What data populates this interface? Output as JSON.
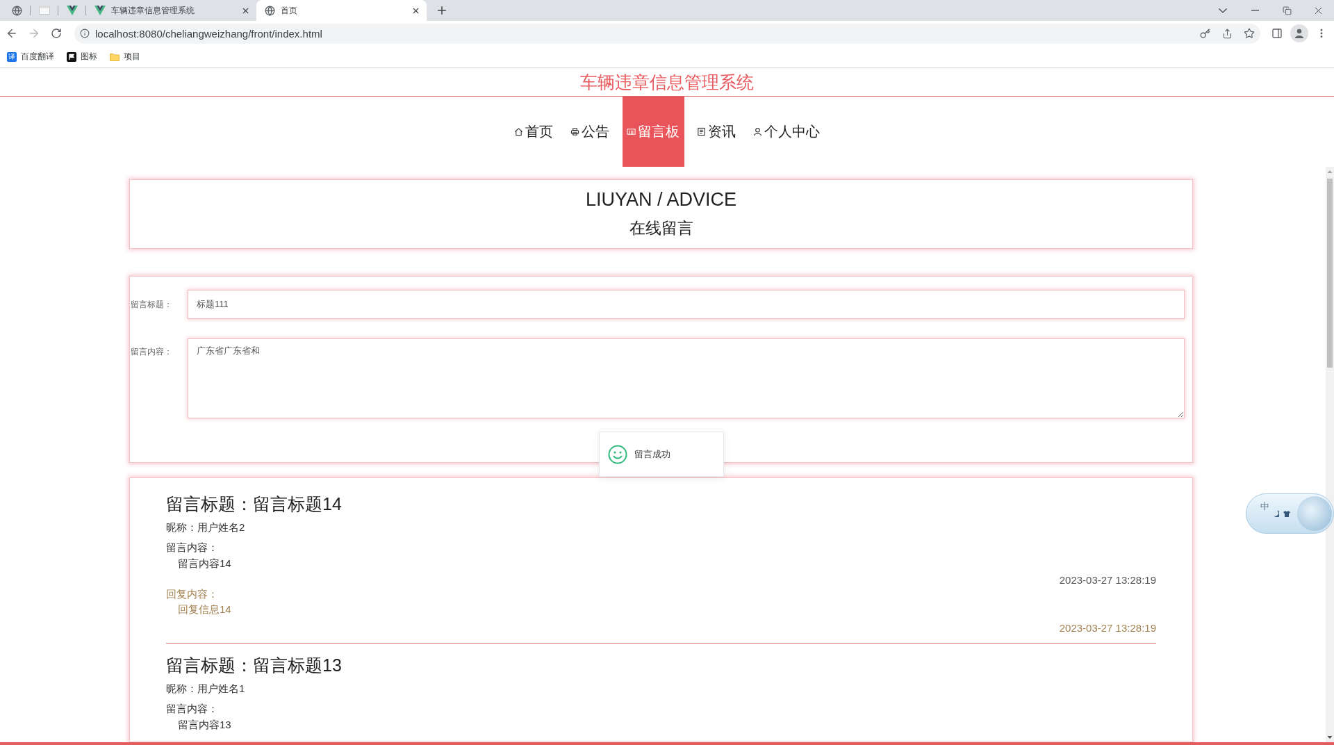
{
  "browser": {
    "tabs": [
      {
        "kind": "globe",
        "selected": false
      },
      {
        "kind": "blank",
        "selected": false
      },
      {
        "kind": "logo",
        "selected": false
      },
      {
        "kind": "logo",
        "title": "车辆违章信息管理系统",
        "selected": false
      },
      {
        "kind": "globe",
        "title": "首页",
        "selected": true
      }
    ],
    "url": "localhost:8080/cheliangweizhang/front/index.html",
    "bookmarks": [
      {
        "kind": "translate",
        "badge": "译",
        "label": "百度翻译"
      },
      {
        "kind": "flag",
        "label": "图标"
      },
      {
        "kind": "folder",
        "label": "项目"
      }
    ]
  },
  "site_title": "车辆违章信息管理系统",
  "nav": [
    {
      "kind": "home",
      "label": "首页",
      "selected": false
    },
    {
      "kind": "notice",
      "label": "公告",
      "selected": false
    },
    {
      "kind": "board",
      "label": "留言板",
      "selected": true
    },
    {
      "kind": "news",
      "label": "资讯",
      "selected": false
    },
    {
      "kind": "user",
      "label": "个人中心",
      "selected": false
    }
  ],
  "banner": {
    "title": "LIUYAN / ADVICE",
    "subtitle": "在线留言"
  },
  "form": {
    "fields": [
      {
        "kind": "input",
        "label": "留言标题：",
        "value": "标题111"
      },
      {
        "kind": "textarea",
        "label": "留言内容：",
        "value": "广东省广东省和"
      }
    ]
  },
  "toast": {
    "text": "留言成功"
  },
  "messages": [
    {
      "title": "留言标题：留言标题14",
      "nickname": "昵称：用户姓名2",
      "content_label": "留言内容：",
      "content": "留言内容14",
      "time": "2023-03-27 13:28:19",
      "reply_label": "回复内容：",
      "reply": "回复信息14",
      "reply_time": "2023-03-27 13:28:19"
    },
    {
      "title": "留言标题：留言标题13",
      "nickname": "昵称：用户姓名1",
      "content_label": "留言内容：",
      "content": "留言内容13"
    }
  ],
  "ime": {
    "mode": "中"
  }
}
